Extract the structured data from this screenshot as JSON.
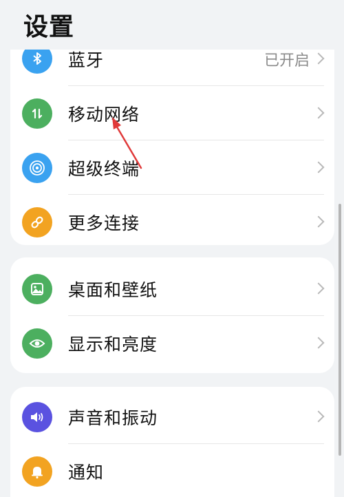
{
  "page_title": "设置",
  "colors": {
    "bluetooth": "#3aa2f0",
    "mobile_network": "#4caf5f",
    "super_device": "#3aa2f0",
    "more_connections": "#f2a321",
    "wallpaper": "#4caf5f",
    "display": "#4caf5f",
    "sound": "#5a52e0",
    "notification": "#f2a321",
    "annotation_arrow": "#e03a3a"
  },
  "groups": [
    {
      "items": [
        {
          "label": "蓝牙",
          "value": "已开启",
          "icon": "bluetooth-icon"
        },
        {
          "label": "移动网络",
          "value": "",
          "icon": "mobile-data-icon"
        },
        {
          "label": "超级终端",
          "value": "",
          "icon": "super-device-icon"
        },
        {
          "label": "更多连接",
          "value": "",
          "icon": "link-icon"
        }
      ]
    },
    {
      "items": [
        {
          "label": "桌面和壁纸",
          "value": "",
          "icon": "wallpaper-icon"
        },
        {
          "label": "显示和亮度",
          "value": "",
          "icon": "eye-icon"
        }
      ]
    },
    {
      "items": [
        {
          "label": "声音和振动",
          "value": "",
          "icon": "speaker-icon"
        },
        {
          "label": "通知",
          "value": "",
          "icon": "bell-icon"
        }
      ]
    }
  ]
}
